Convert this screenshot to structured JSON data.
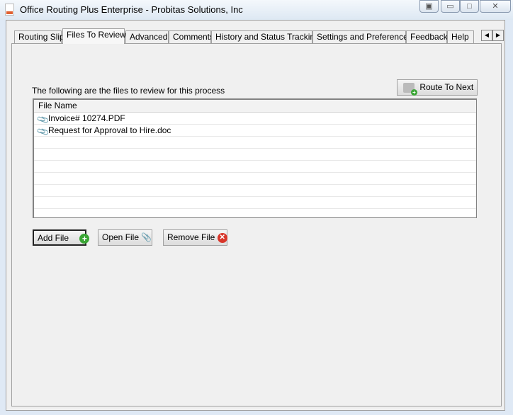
{
  "window": {
    "title": "Office Routing Plus Enterprise - Probitas Solutions, Inc"
  },
  "tabs": [
    "Routing Slip",
    "Files To Review",
    "Advanced",
    "Comments",
    "History and Status Tracking",
    "Settings and Preferences",
    "Feedback",
    "Help"
  ],
  "active_tab": "Files To Review",
  "main": {
    "description": "The following are the files to review for this process",
    "route_button": "Route To Next",
    "list": {
      "header": "File Name",
      "files": [
        "Invoice# 10274.PDF",
        "Request for Approval to Hire.doc"
      ]
    },
    "add_button": "Add File",
    "open_button": "Open File",
    "remove_button": "Remove File"
  }
}
